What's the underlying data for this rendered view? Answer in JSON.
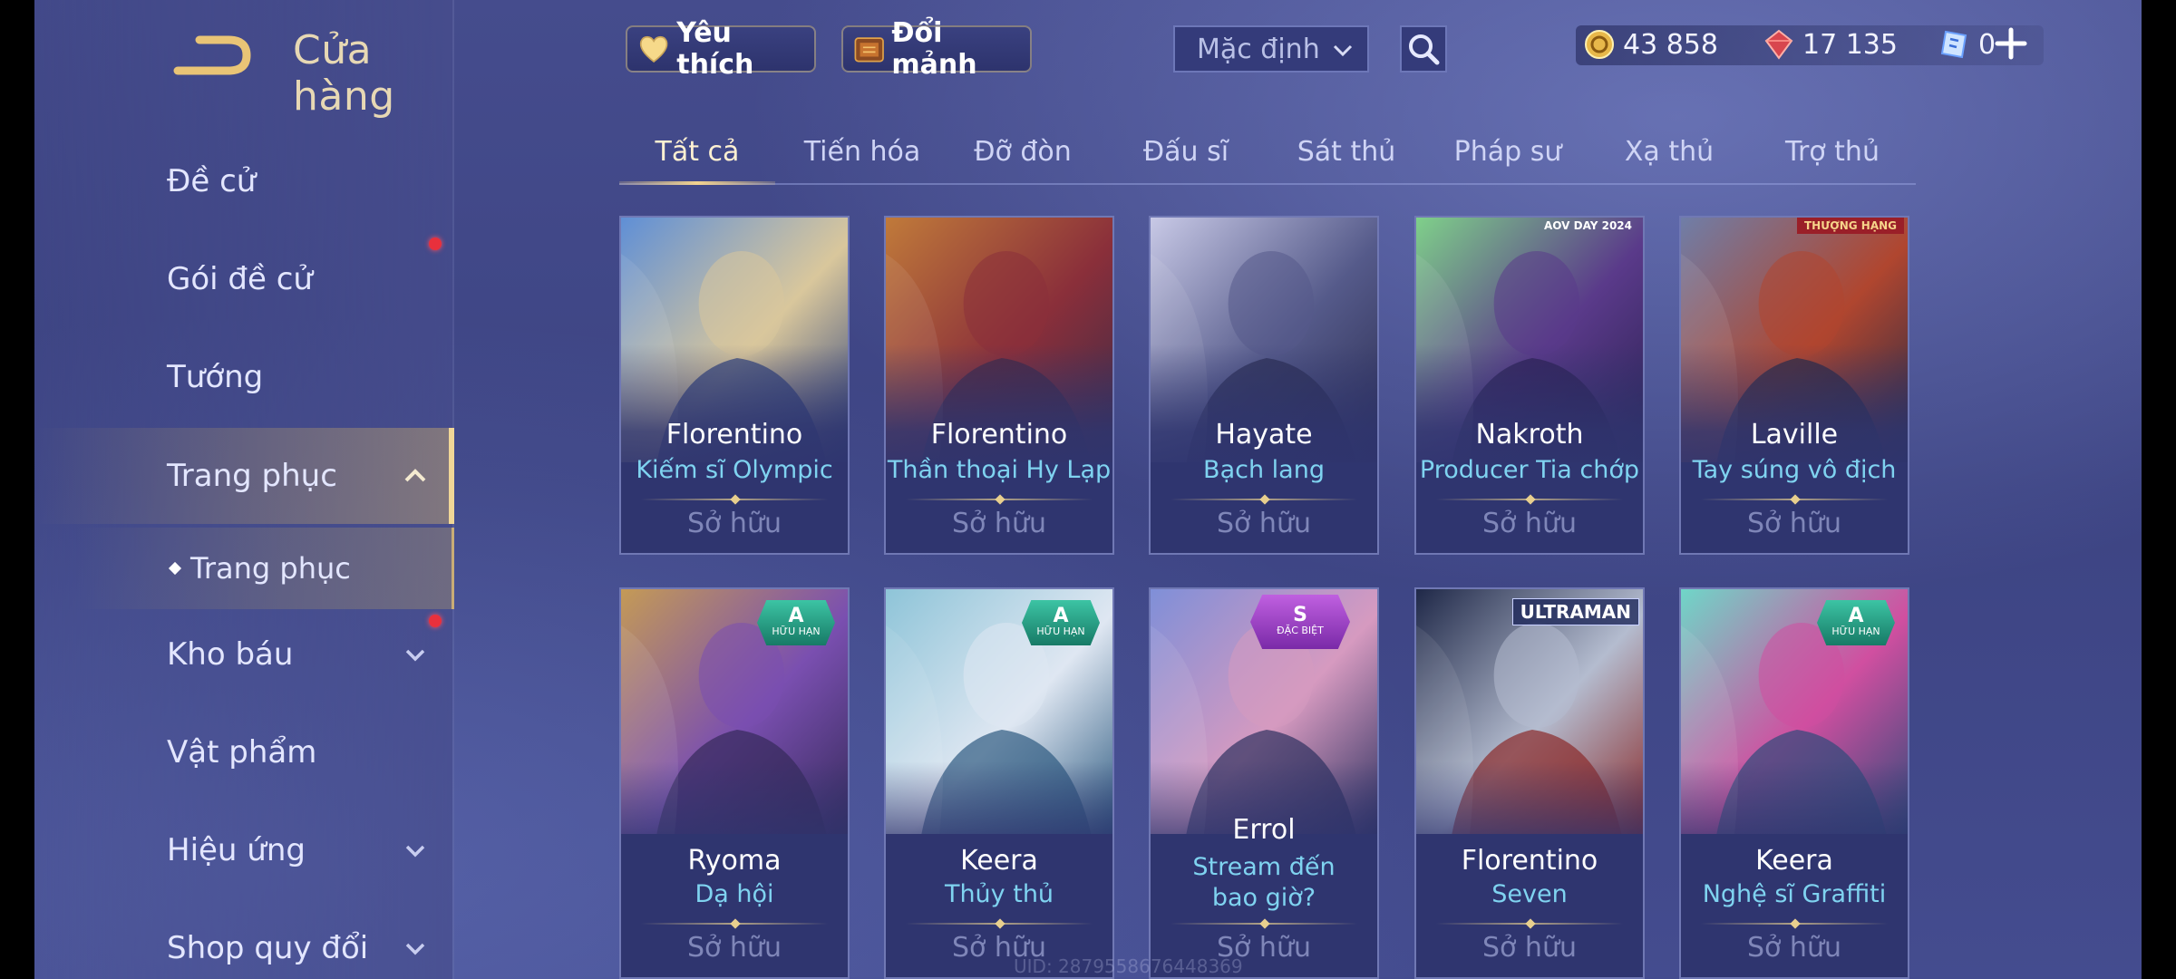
{
  "header": {
    "title": "Cửa hàng",
    "back_icon": "back-arrow-icon"
  },
  "sidebar": {
    "items": [
      {
        "label": "Đề cử",
        "notify": false
      },
      {
        "label": "Gói đề cử",
        "notify": true
      },
      {
        "label": "Tướng",
        "notify": false
      },
      {
        "label": "Trang phục",
        "expanded": true,
        "active": true
      },
      {
        "label": "Trang phục",
        "sub": true
      },
      {
        "label": "Kho báu",
        "notify": true,
        "expandable": true
      },
      {
        "label": "Vật phẩm"
      },
      {
        "label": "Hiệu ứng",
        "expandable": true
      },
      {
        "label": "Shop quy đổi",
        "expandable": true
      }
    ]
  },
  "topbar": {
    "favorites_label": "Yêu thích",
    "exchange_label": "Đổi mảnh",
    "sort_value": "Mặc định",
    "currencies": [
      {
        "icon": "gold-coin-icon",
        "value": "43 858",
        "color": "#f1c35a"
      },
      {
        "icon": "ruby-gem-icon",
        "value": "17 135",
        "color": "#e0505a"
      },
      {
        "icon": "blue-voucher-icon",
        "value": "0",
        "color": "#7fb3ff"
      }
    ]
  },
  "tabs": [
    "Tất cả",
    "Tiến hóa",
    "Đỡ đòn",
    "Đấu sĩ",
    "Sát thủ",
    "Pháp sư",
    "Xạ thủ",
    "Trợ thủ"
  ],
  "active_tab": "Tất cả",
  "skins": [
    {
      "hero": "Florentino",
      "skin": "Kiếm sĩ Olympic",
      "status": "Sở hữu",
      "colors": [
        "#5f8fd6",
        "#d9c79c",
        "#2b3f7a"
      ]
    },
    {
      "hero": "Florentino",
      "skin": "Thần thoại Hy Lạp",
      "status": "Sở hữu",
      "colors": [
        "#c07a3a",
        "#8a2f3a",
        "#3a2a48"
      ]
    },
    {
      "hero": "Hayate",
      "skin": "Bạch lang",
      "status": "Sở hữu",
      "colors": [
        "#c8c9e6",
        "#555a8a",
        "#2a2c50"
      ]
    },
    {
      "hero": "Nakroth",
      "skin": "Producer Tia chớp",
      "status": "Sở hữu",
      "colors": [
        "#7fd08a",
        "#5a3a8a",
        "#2a2050"
      ],
      "tag_text": "AOV DAY 2024"
    },
    {
      "hero": "Laville",
      "skin": "Tay súng vô địch",
      "status": "Sở hữu",
      "colors": [
        "#6f7ea8",
        "#b0462f",
        "#242845"
      ],
      "tag_text": "THƯỢNG HẠNG"
    },
    {
      "hero": "Ryoma",
      "skin": "Dạ hội",
      "status": "Sở hữu",
      "colors": [
        "#c49a56",
        "#7a4fb0",
        "#352a5a"
      ],
      "badge": {
        "grade": "A",
        "sub": "HỮU HẠN"
      }
    },
    {
      "hero": "Keera",
      "skin": "Thủy thủ",
      "status": "Sở hữu",
      "colors": [
        "#8ec4d8",
        "#dfe7f2",
        "#2d5a80"
      ],
      "badge": {
        "grade": "A",
        "sub": "HỮU HẠN"
      }
    },
    {
      "hero": "Errol",
      "skin": "Stream đến bao giờ?",
      "status": "Sở hữu",
      "colors": [
        "#7f8fd8",
        "#d69ac0",
        "#2e3160"
      ],
      "badge": {
        "grade": "S",
        "sub": "ĐẶC BIỆT"
      }
    },
    {
      "hero": "Florentino",
      "skin": "Seven",
      "status": "Sở hữu",
      "colors": [
        "#1f2848",
        "#b4bccf",
        "#8a2a2a"
      ],
      "tag_text": "ULTRAMAN"
    },
    {
      "hero": "Keera",
      "skin": "Nghệ sĩ Graffiti",
      "status": "Sở hữu",
      "colors": [
        "#6fd6c8",
        "#d04fa0",
        "#2f4a7a"
      ],
      "badge": {
        "grade": "A",
        "sub": "HỮU HẠN"
      }
    }
  ],
  "uid_text": "UID: 2879558676448369"
}
